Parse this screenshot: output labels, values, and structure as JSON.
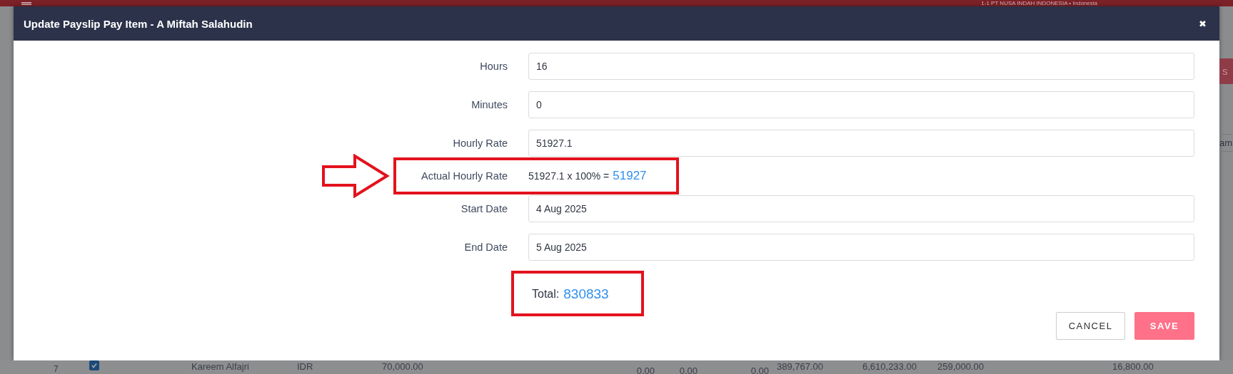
{
  "background": {
    "company": "1-1 PT NUSA INDAH INDONESIA • Indonesia",
    "side_fragments": [
      "s",
      "am"
    ],
    "row": {
      "number": "7",
      "checked": true,
      "cells": [
        "Kareem Alfajri",
        "IDR",
        "70,000.00",
        "0.00",
        "0.00",
        "0.00",
        "389,767.00",
        "6,610,233.00",
        "259,000.00",
        "16,800.00"
      ]
    }
  },
  "dialog": {
    "title": "Update Payslip Pay Item - A Miftah Salahudin",
    "close": "✖",
    "fields": [
      {
        "kind": "input",
        "label": "Hours",
        "value": "16"
      },
      {
        "kind": "input",
        "label": "Minutes",
        "value": "0"
      },
      {
        "kind": "input",
        "label": "Hourly Rate",
        "value": "51927.1"
      },
      {
        "kind": "formula",
        "label": "Actual Hourly Rate",
        "formula": "51927.1 x 100% =",
        "result": "51927",
        "highlighted": true,
        "arrow": true
      },
      {
        "kind": "input",
        "label": "Start Date",
        "value": "4 Aug 2025"
      },
      {
        "kind": "input",
        "label": "End Date",
        "value": "5 Aug 2025"
      }
    ],
    "total": {
      "label": "Total:",
      "value": "830833",
      "highlighted": true
    },
    "buttons": [
      {
        "kind": "cancel",
        "label": "CANCEL"
      },
      {
        "kind": "save",
        "label": "SAVE"
      }
    ]
  }
}
